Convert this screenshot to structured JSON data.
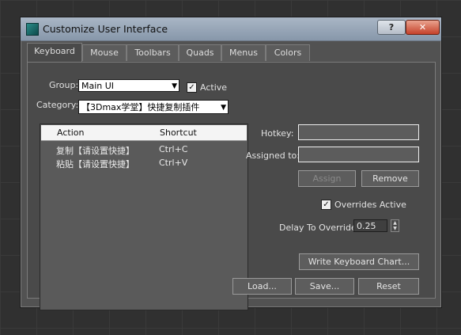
{
  "window": {
    "title": "Customize User Interface",
    "help_label": "?",
    "close_label": "✕"
  },
  "tabs": [
    {
      "label": "Keyboard",
      "active": true
    },
    {
      "label": "Mouse"
    },
    {
      "label": "Toolbars"
    },
    {
      "label": "Quads"
    },
    {
      "label": "Menus"
    },
    {
      "label": "Colors"
    }
  ],
  "keyboard": {
    "group_label": "Group:",
    "group_value": "Main UI",
    "active_label": "Active",
    "active_checked": true,
    "category_label": "Category:",
    "category_value": "【3Dmax学堂】快捷复制插件",
    "list": {
      "col_action": "Action",
      "col_shortcut": "Shortcut",
      "rows": [
        {
          "action": "复制【请设置快捷】",
          "shortcut": "Ctrl+C"
        },
        {
          "action": "粘贴【请设置快捷】",
          "shortcut": "Ctrl+V"
        }
      ]
    },
    "hotkey_label": "Hotkey:",
    "hotkey_value": "",
    "assigned_label": "Assigned to:",
    "assigned_value": "",
    "assign_button": "Assign",
    "remove_button": "Remove",
    "overrides_label": "Overrides Active",
    "overrides_checked": true,
    "delay_label": "Delay To Override:",
    "delay_value": "0.25",
    "write_chart_button": "Write Keyboard Chart...",
    "load_button": "Load...",
    "save_button": "Save...",
    "reset_button": "Reset"
  }
}
